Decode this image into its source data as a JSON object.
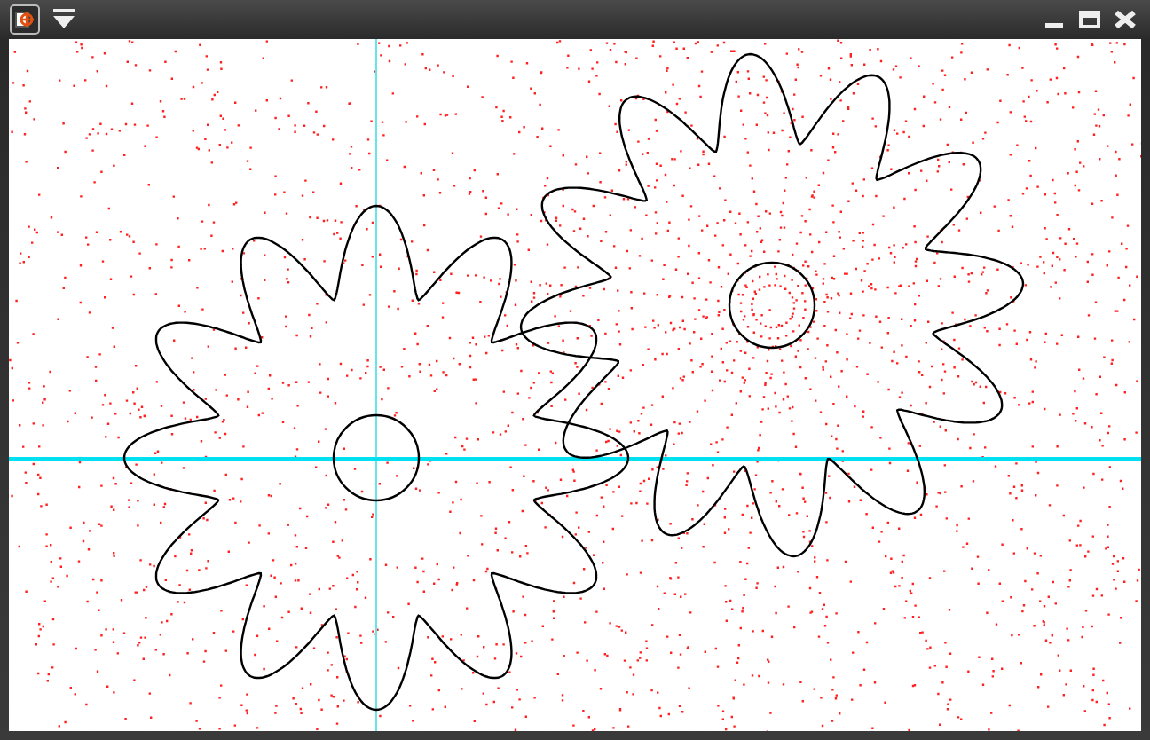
{
  "title_bar": {
    "left_icons": [
      {
        "kind": "app"
      },
      {
        "kind": "menu"
      }
    ],
    "buttons": [
      {
        "kind": "minimize"
      },
      {
        "kind": "maximize"
      },
      {
        "kind": "close"
      }
    ]
  }
}
